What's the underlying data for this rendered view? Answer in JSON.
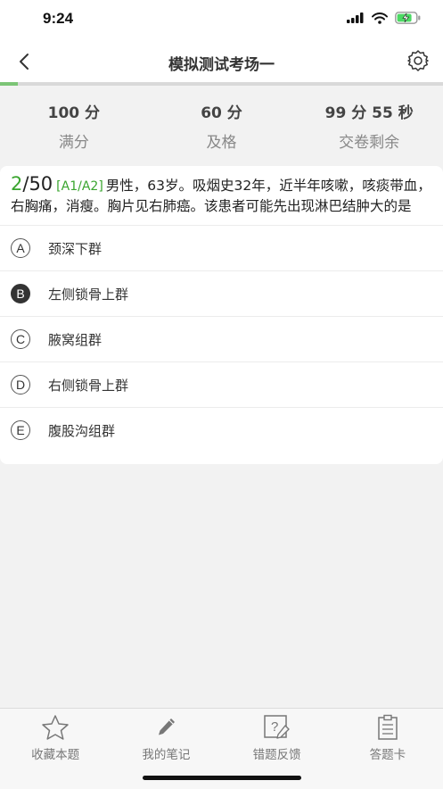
{
  "status_bar": {
    "time": "9:24"
  },
  "nav": {
    "title": "模拟测试考场一"
  },
  "progress": {
    "fraction": 0.04
  },
  "scores": [
    {
      "value": "100 分",
      "label": "满分"
    },
    {
      "value": "60 分",
      "label": "及格"
    },
    {
      "value": "99 分 55 秒",
      "label": "交卷剩余"
    }
  ],
  "question": {
    "current": "2",
    "total": "/50",
    "type": "[A1/A2]",
    "text": "男性，63岁。吸烟史32年，近半年咳嗽，咳痰带血，右胸痛，消瘦。胸片见右肺癌。该患者可能先出现淋巴结肿大的是"
  },
  "options": [
    {
      "letter": "A",
      "text": "颈深下群",
      "selected": false
    },
    {
      "letter": "B",
      "text": "左侧锁骨上群",
      "selected": true
    },
    {
      "letter": "C",
      "text": "腋窝组群",
      "selected": false
    },
    {
      "letter": "D",
      "text": "右侧锁骨上群",
      "selected": false
    },
    {
      "letter": "E",
      "text": "腹股沟组群",
      "selected": false
    }
  ],
  "tabs": [
    {
      "label": "收藏本题",
      "icon": "star-icon"
    },
    {
      "label": "我的笔记",
      "icon": "pencil-icon"
    },
    {
      "label": "错题反馈",
      "icon": "feedback-icon"
    },
    {
      "label": "答题卡",
      "icon": "answer-sheet-icon"
    }
  ],
  "colors": {
    "accent": "#3aa52f",
    "progress": "#7cc576"
  }
}
